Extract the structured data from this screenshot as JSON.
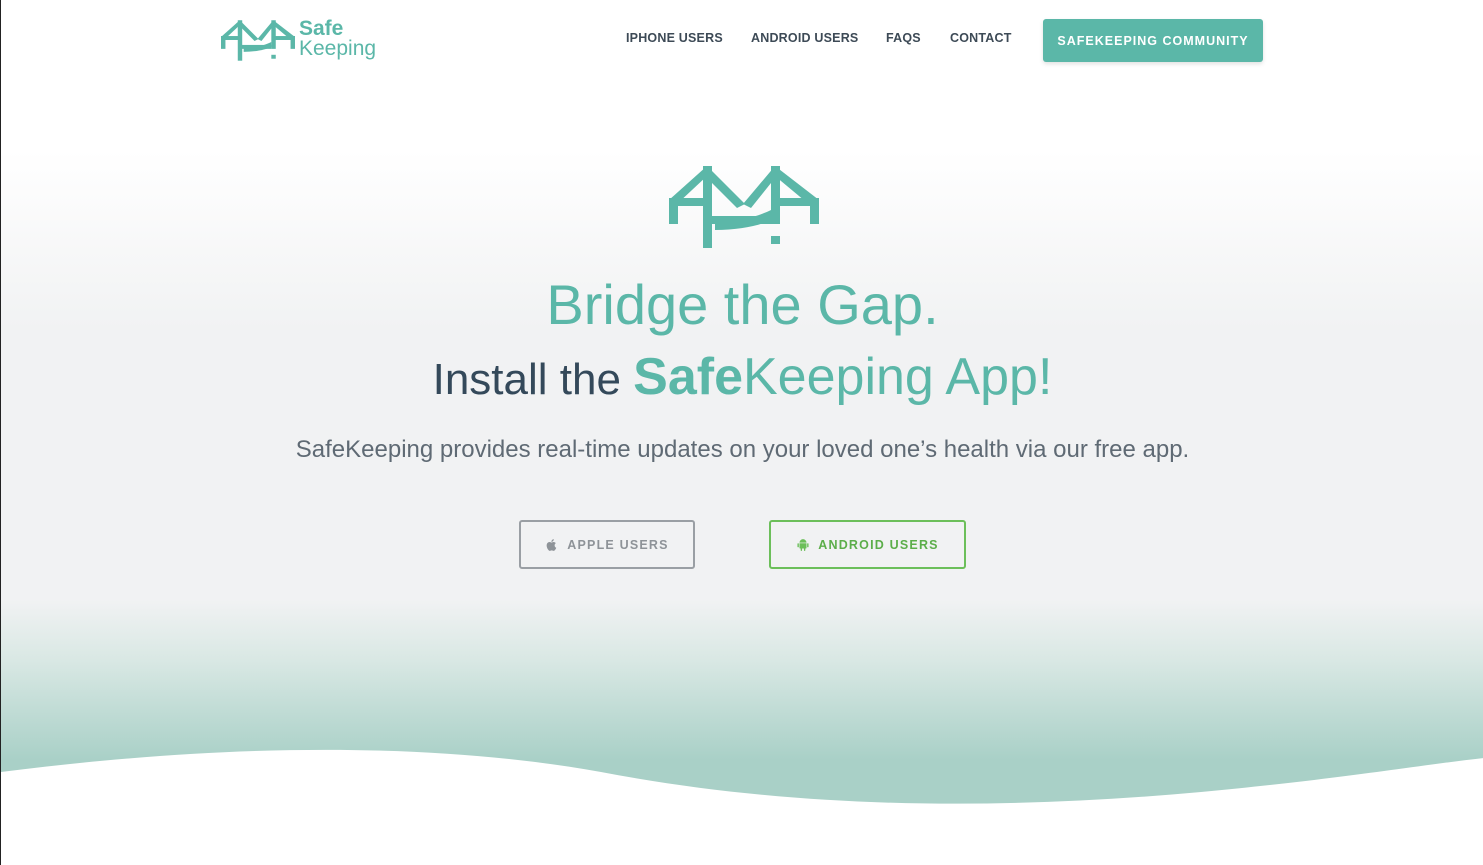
{
  "brand": {
    "logo_line1": "Safe",
    "logo_line2": "Keeping",
    "logo_icon": "bridge-logo-icon",
    "color_primary": "#5bb7a8",
    "color_dark": "#34495a",
    "color_android": "#6cbf5a"
  },
  "nav": {
    "items": [
      {
        "label": "IPHONE USERS"
      },
      {
        "label": "ANDROID USERS"
      },
      {
        "label": "FAQS"
      },
      {
        "label": "CONTACT"
      }
    ],
    "cta_label": "SAFEKEEPING COMMUNITY"
  },
  "hero": {
    "icon": "bridge-icon",
    "headline": "Bridge the Gap.",
    "subheadline_prefix": "Install the ",
    "subheadline_bold": "Safe",
    "subheadline_rest": "Keeping App!",
    "description": "SafeKeeping provides real-time updates on your loved one’s health via our free app.",
    "apple_button": {
      "label": "APPLE USERS",
      "icon": "apple-icon"
    },
    "android_button": {
      "label": "ANDROID USERS",
      "icon": "android-icon"
    }
  }
}
